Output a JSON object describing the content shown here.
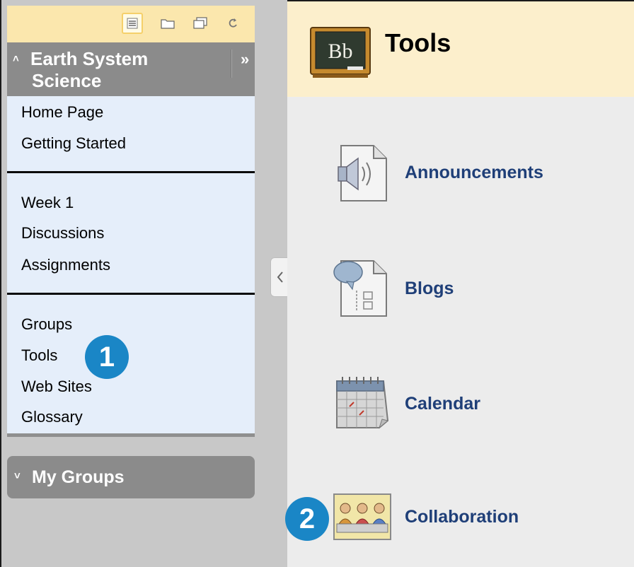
{
  "toolbar": {
    "icons": [
      "list-view-icon",
      "folder-view-icon",
      "new-window-icon",
      "refresh-icon"
    ]
  },
  "course": {
    "title_line1": "Earth System",
    "title_line2": "Science",
    "collapse_glyph": "˄",
    "expand_glyph": "»"
  },
  "menu": {
    "section1": [
      "Home Page",
      "Getting Started"
    ],
    "section2": [
      "Week 1",
      "Discussions",
      "Assignments"
    ],
    "section3": [
      "Groups",
      "Tools",
      "Web Sites",
      "Glossary"
    ]
  },
  "my_groups": {
    "label": "My Groups",
    "glyph": "˅"
  },
  "page": {
    "title": "Tools",
    "logo_text": "Bb"
  },
  "tools": [
    {
      "label": "Announcements",
      "icon": "announcements-icon"
    },
    {
      "label": "Blogs",
      "icon": "blogs-icon"
    },
    {
      "label": "Calendar",
      "icon": "calendar-icon"
    },
    {
      "label": "Collaboration",
      "icon": "collaboration-icon"
    }
  ],
  "callouts": {
    "one": "1",
    "two": "2"
  },
  "colors": {
    "toolbar_bg": "#fbe7ad",
    "header_gray": "#8b8b8b",
    "menu_bg": "#e5eefa",
    "page_header_bg": "#fcefcc",
    "tool_link": "#1f3f78",
    "callout_blue": "#1a86c6"
  }
}
